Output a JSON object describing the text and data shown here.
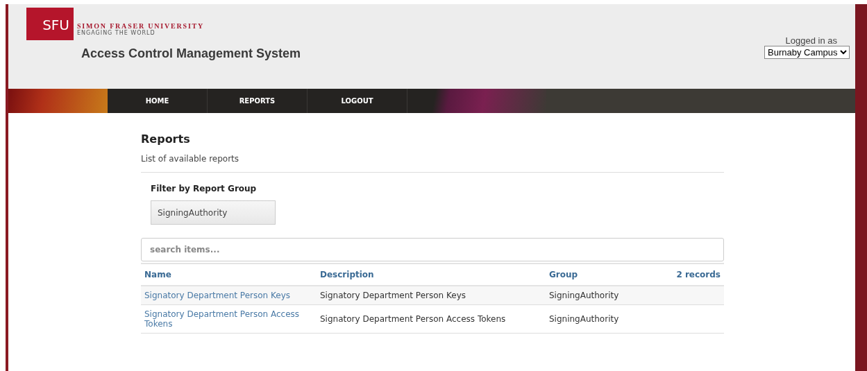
{
  "brand": {
    "logo": "SFU",
    "university": "SIMON FRASER UNIVERSITY",
    "tagline": "ENGAGING THE WORLD",
    "system": "Access Control Management System"
  },
  "user": {
    "label": "Logged in as",
    "campus": "Burnaby Campus"
  },
  "nav": [
    {
      "label": "HOME",
      "selected": false
    },
    {
      "label": "REPORTS",
      "selected": false
    },
    {
      "label": "LOGOUT",
      "selected": false
    }
  ],
  "page": {
    "title": "Reports",
    "subtitle": "List of available reports"
  },
  "filter": {
    "label": "Filter by Report Group",
    "value": "SigningAuthority"
  },
  "search": {
    "placeholder": "search items..."
  },
  "table": {
    "columns": [
      "Name",
      "Description",
      "Group"
    ],
    "count": "2 records",
    "rows": [
      {
        "name": "Signatory Department Person Keys",
        "description": "Signatory Department Person Keys",
        "group": "SigningAuthority"
      },
      {
        "name": "Signatory Department Person Access Tokens",
        "description": "Signatory Department Person Access Tokens",
        "group": "SigningAuthority"
      }
    ]
  }
}
